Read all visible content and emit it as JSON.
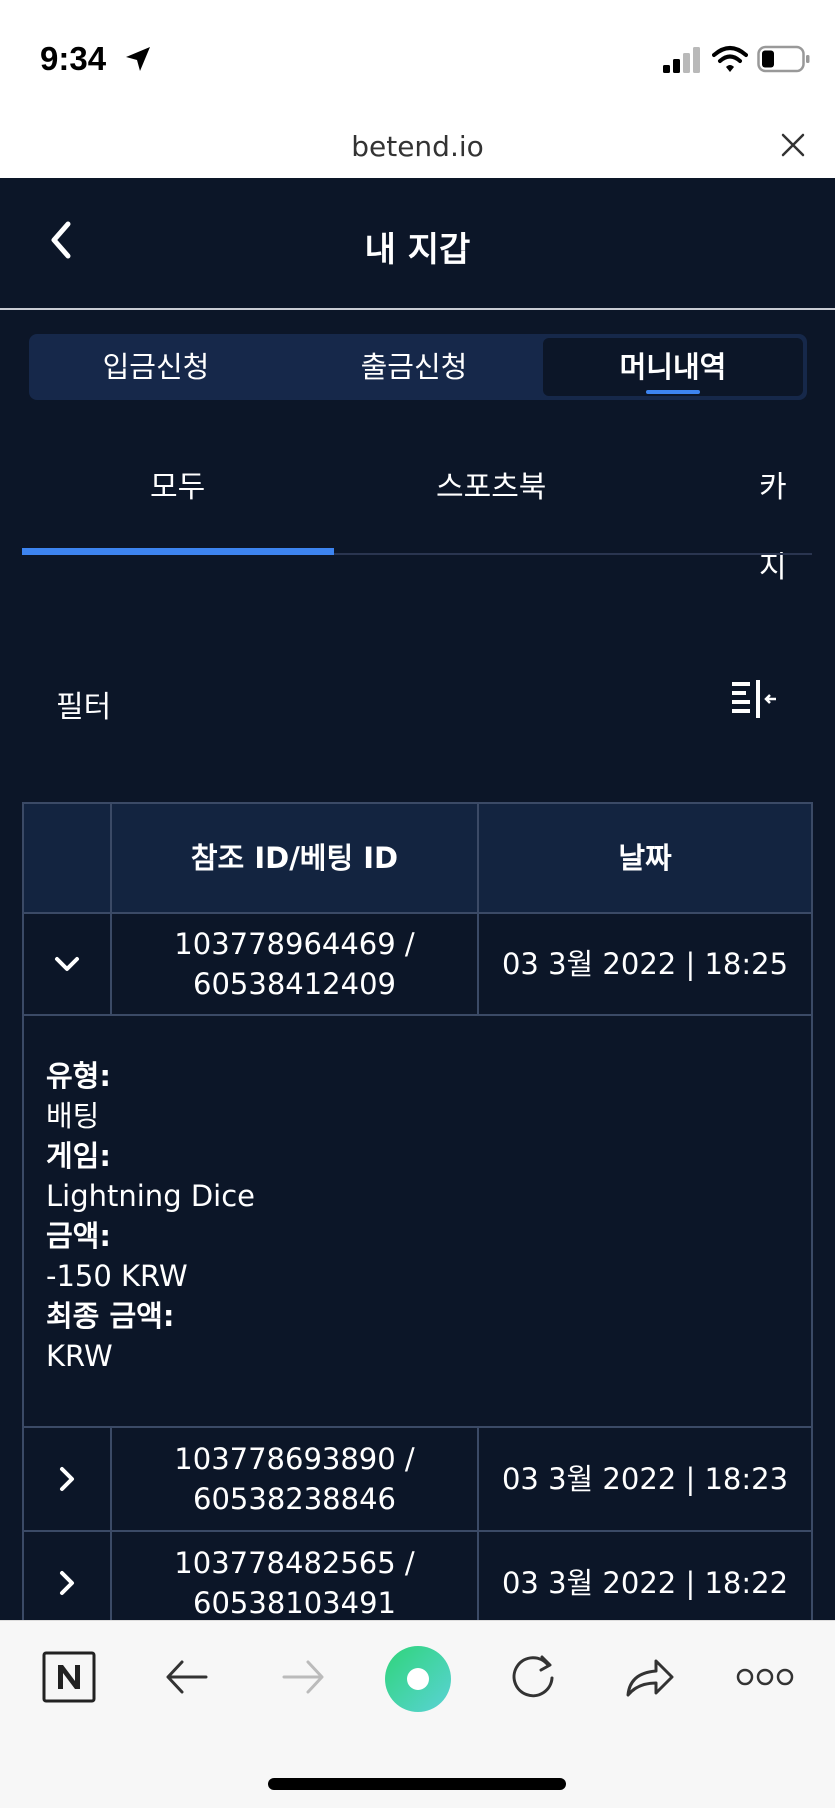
{
  "status_bar": {
    "time": "9:34"
  },
  "browser": {
    "url": "betend.io"
  },
  "header": {
    "title": "내 지갑"
  },
  "wallet_tabs": [
    {
      "label": "입금신청",
      "active": false
    },
    {
      "label": "출금신청",
      "active": false
    },
    {
      "label": "머니내역",
      "active": true
    }
  ],
  "category_tabs": [
    {
      "label": "모두",
      "active": true
    },
    {
      "label": "스포츠북",
      "active": false
    },
    {
      "label": "카지",
      "active": false
    }
  ],
  "filter": {
    "label": "필터"
  },
  "table": {
    "headers": [
      "",
      "참조 ID/베팅 ID",
      "날짜"
    ],
    "rows": [
      {
        "ref_id": "103778964469 /",
        "bet_id": "60538412409",
        "date": "03 3월 2022 | 18:25",
        "expanded": true
      },
      {
        "ref_id": "103778693890 /",
        "bet_id": "60538238846",
        "date": "03 3월 2022 | 18:23",
        "expanded": false
      },
      {
        "ref_id": "103778482565 /",
        "bet_id": "60538103491",
        "date": "03 3월 2022 | 18:22",
        "expanded": false
      }
    ],
    "details": {
      "type_label": "유형:",
      "type_value": "배팅",
      "game_label": "게임:",
      "game_value": "Lightning Dice",
      "amount_label": "금액:",
      "amount_value": "-150 KRW",
      "final_label": "최종 금액:",
      "final_value": "KRW"
    }
  },
  "colors": {
    "background": "#0c1628",
    "accent": "#3d84f0",
    "segment_bg": "#16284a"
  }
}
